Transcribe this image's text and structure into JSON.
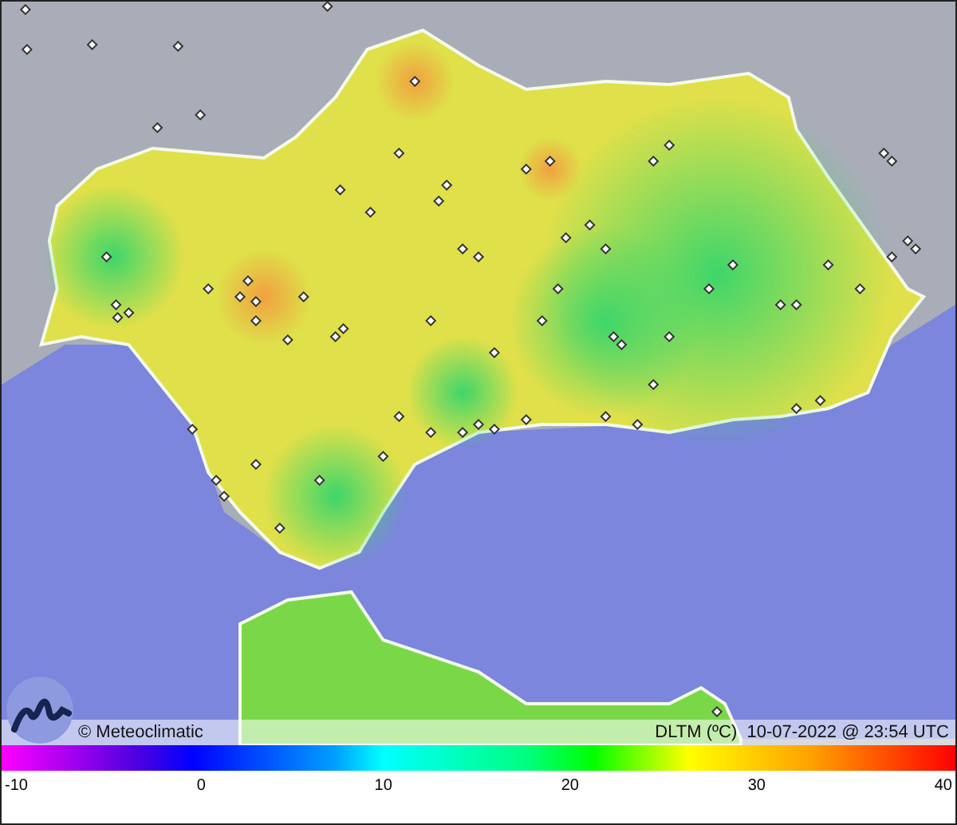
{
  "map": {
    "credit": "© Meteoclimatic",
    "caption": "DLTM (ºC)  10-07-2022 @ 23:54 UTC"
  },
  "scale": {
    "ticks": [
      "-10",
      "0",
      "10",
      "20",
      "30",
      "40"
    ]
  }
}
